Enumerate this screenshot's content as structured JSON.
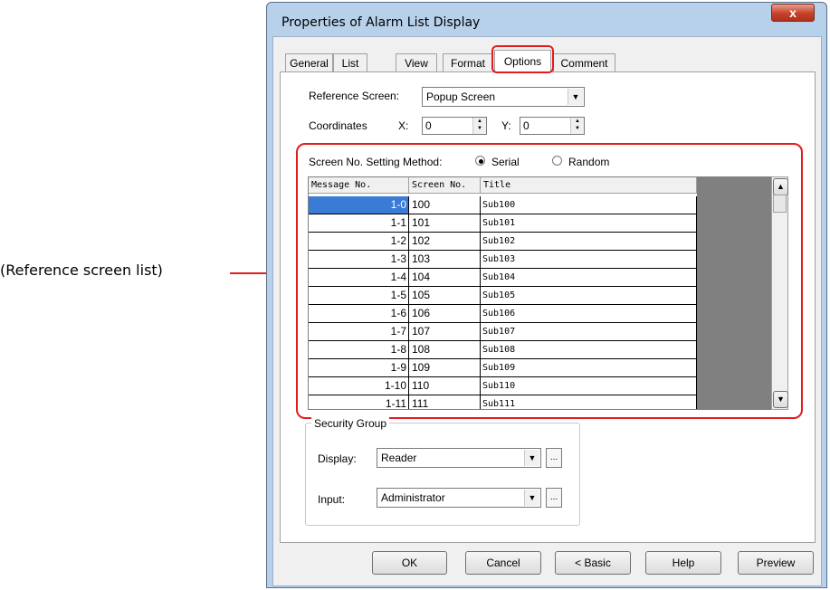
{
  "callout": {
    "label": "(Reference screen list)"
  },
  "dialog": {
    "title": "Properties of Alarm List Display",
    "close": "x"
  },
  "tabs": [
    {
      "label": "General"
    },
    {
      "label": "List"
    },
    {
      "label": "View"
    },
    {
      "label": "Format"
    },
    {
      "label": "Options"
    },
    {
      "label": "Comment"
    }
  ],
  "reference_screen": {
    "label": "Reference Screen:",
    "value": "Popup Screen"
  },
  "coordinates": {
    "label": "Coordinates",
    "x_label": "X:",
    "x_value": "0",
    "y_label": "Y:",
    "y_value": "0"
  },
  "method": {
    "label": "Screen No. Setting Method:",
    "serial": "Serial",
    "random": "Random",
    "selected": "Serial"
  },
  "grid": {
    "headers": [
      "Message No.",
      "Screen No.",
      "Title"
    ],
    "rows": [
      [
        "1-0",
        "100",
        "Sub100"
      ],
      [
        "1-1",
        "101",
        "Sub101"
      ],
      [
        "1-2",
        "102",
        "Sub102"
      ],
      [
        "1-3",
        "103",
        "Sub103"
      ],
      [
        "1-4",
        "104",
        "Sub104"
      ],
      [
        "1-5",
        "105",
        "Sub105"
      ],
      [
        "1-6",
        "106",
        "Sub106"
      ],
      [
        "1-7",
        "107",
        "Sub107"
      ],
      [
        "1-8",
        "108",
        "Sub108"
      ],
      [
        "1-9",
        "109",
        "Sub109"
      ],
      [
        "1-10",
        "110",
        "Sub110"
      ],
      [
        "1-11",
        "111",
        "Sub111"
      ]
    ]
  },
  "security": {
    "title": "Security Group",
    "display_label": "Display:",
    "display_value": "Reader",
    "input_label": "Input:",
    "input_value": "Administrator",
    "ellipsis": "..."
  },
  "buttons": {
    "ok": "OK",
    "cancel": "Cancel",
    "basic": "< Basic",
    "help": "Help",
    "preview": "Preview"
  },
  "colors": {
    "highlight": "#e41c1c",
    "selection": "#3a7bd5",
    "frame": "#b8d1ea"
  }
}
